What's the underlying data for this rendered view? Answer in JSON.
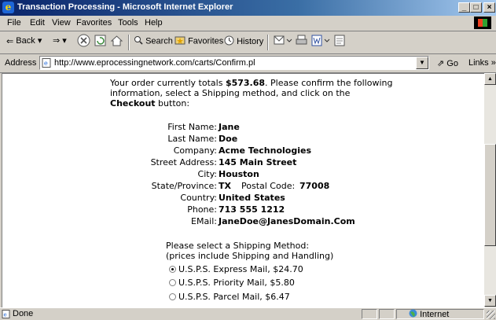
{
  "window": {
    "title": "Transaction Processing - Microsoft Internet Explorer"
  },
  "menu": [
    "File",
    "Edit",
    "View",
    "Favorites",
    "Tools",
    "Help"
  ],
  "toolbar": {
    "back": "Back",
    "search": "Search",
    "favorites": "Favorites",
    "history": "History"
  },
  "address": {
    "label": "Address",
    "url": "http://www.eprocessingnetwork.com/carts/Confirm.pl",
    "go": "Go",
    "links": "Links"
  },
  "order": {
    "intro_1": "Your order currently totals ",
    "total": "$573.68",
    "intro_2": ". Please confirm the following information, select a Shipping method, and click on the ",
    "checkout": "Checkout",
    "intro_3": " button:"
  },
  "fields": [
    {
      "label": "First Name:",
      "value": "Jane"
    },
    {
      "label": "Last Name:",
      "value": "Doe"
    },
    {
      "label": "Company:",
      "value": "Acme Technologies"
    },
    {
      "label": "Street Address:",
      "value": "145 Main Street"
    },
    {
      "label": "City:",
      "value": "Houston"
    },
    {
      "label": "State/Province:",
      "value": "TX",
      "extra_label": "Postal Code:",
      "extra_value": "77008"
    },
    {
      "label": "Country:",
      "value": "United States"
    },
    {
      "label": "Phone:",
      "value": "713 555 1212"
    },
    {
      "label": "EMail:",
      "value": "JaneDoe@JanesDomain.Com"
    }
  ],
  "shipping": {
    "prompt_1": "Please select a Shipping Method:",
    "prompt_2": "(prices include Shipping and Handling)",
    "options": [
      {
        "label": "U.S.P.S. Express Mail, $24.70",
        "selected": true
      },
      {
        "label": "U.S.P.S. Priority Mail, $5.80",
        "selected": false
      },
      {
        "label": "U.S.P.S. Parcel Mail, $6.47",
        "selected": false
      }
    ]
  },
  "status": {
    "text": "Done",
    "zone": "Internet"
  }
}
